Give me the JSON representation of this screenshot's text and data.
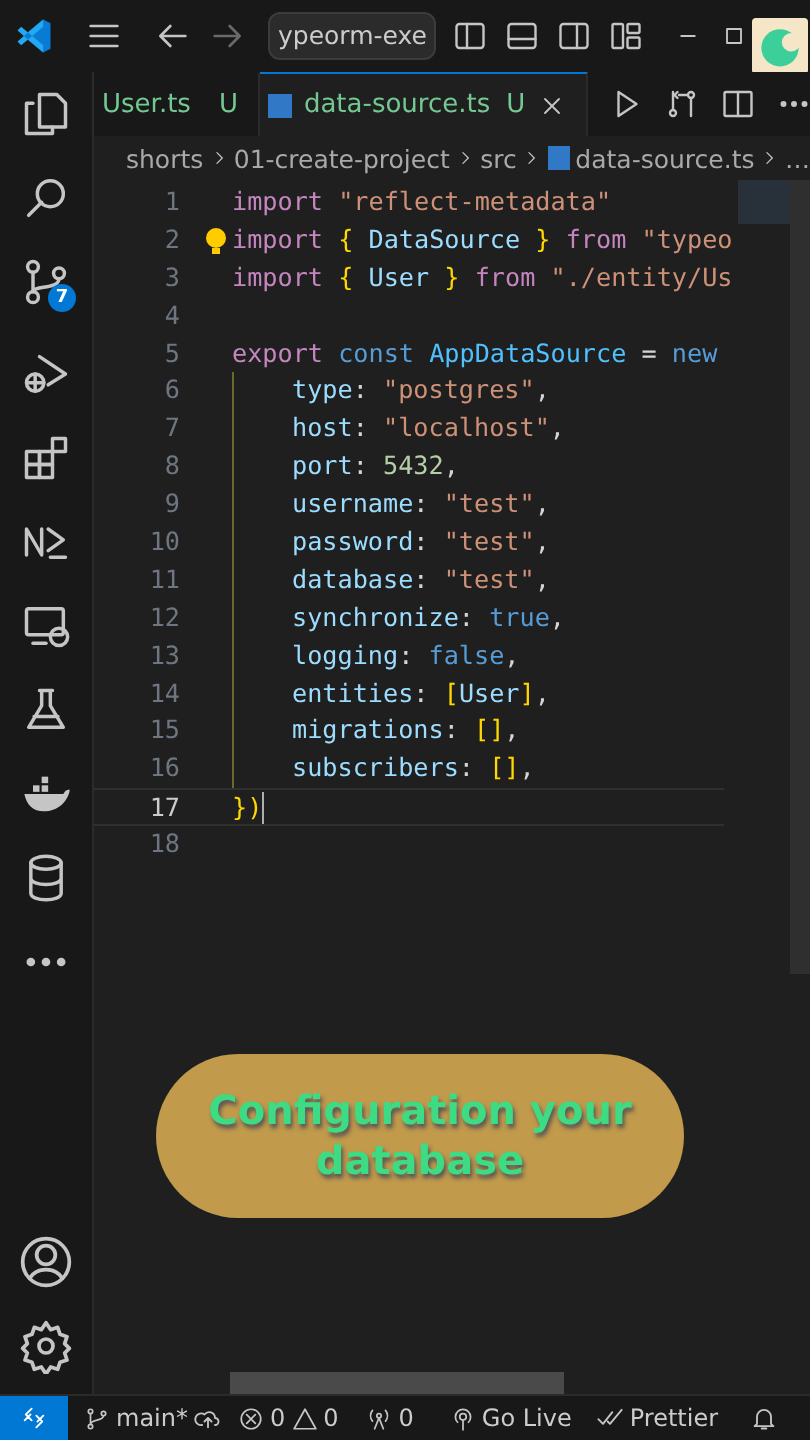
{
  "title_bar": {
    "search": "ypeorm-exe"
  },
  "tabs": [
    {
      "label": "User.ts",
      "status": "U",
      "selected": false
    },
    {
      "label": "data-source.ts",
      "status": "U",
      "selected": true
    }
  ],
  "breadcrumb": [
    "shorts",
    "01-create-project",
    "src",
    "data-source.ts",
    "…"
  ],
  "source_control_badge": "7",
  "editor": {
    "lines": [
      {
        "number": "1",
        "indented": false,
        "current": false,
        "tokens": [
          {
            "kind": "keyword",
            "text": "import "
          },
          {
            "kind": "string",
            "text": "\"reflect-metadata\""
          }
        ]
      },
      {
        "number": "2",
        "indented": false,
        "current": false,
        "tokens": [
          {
            "kind": "keyword",
            "text": "import "
          },
          {
            "kind": "brace",
            "text": "{"
          },
          {
            "kind": "variable",
            "text": " DataSource "
          },
          {
            "kind": "brace",
            "text": "} "
          },
          {
            "kind": "keyword",
            "text": "from "
          },
          {
            "kind": "string",
            "text": "\"typeo"
          }
        ]
      },
      {
        "number": "3",
        "indented": false,
        "current": false,
        "tokens": [
          {
            "kind": "keyword",
            "text": "import "
          },
          {
            "kind": "brace",
            "text": "{"
          },
          {
            "kind": "variable",
            "text": " User "
          },
          {
            "kind": "brace",
            "text": "} "
          },
          {
            "kind": "keyword",
            "text": "from "
          },
          {
            "kind": "string",
            "text": "\"./entity/Us"
          }
        ]
      },
      {
        "number": "4",
        "indented": false,
        "current": false
      },
      {
        "number": "5",
        "indented": false,
        "current": false,
        "tokens": [
          {
            "kind": "keyword",
            "text": "export "
          },
          {
            "kind": "storage",
            "text": "const "
          },
          {
            "kind": "constant",
            "text": "AppDataSource"
          },
          {
            "kind": "plain",
            "text": " = "
          },
          {
            "kind": "storage",
            "text": "new"
          }
        ]
      },
      {
        "number": "6",
        "indented": true,
        "current": false,
        "tokens": [
          {
            "kind": "variable",
            "text": "type"
          },
          {
            "kind": "plain",
            "text": ": "
          },
          {
            "kind": "string",
            "text": "\"postgres\""
          },
          {
            "kind": "plain",
            "text": ","
          }
        ]
      },
      {
        "number": "7",
        "indented": true,
        "current": false,
        "tokens": [
          {
            "kind": "variable",
            "text": "host"
          },
          {
            "kind": "plain",
            "text": ": "
          },
          {
            "kind": "string",
            "text": "\"localhost\""
          },
          {
            "kind": "plain",
            "text": ","
          }
        ]
      },
      {
        "number": "8",
        "indented": true,
        "current": false,
        "tokens": [
          {
            "kind": "variable",
            "text": "port"
          },
          {
            "kind": "plain",
            "text": ": "
          },
          {
            "kind": "number",
            "text": "5432"
          },
          {
            "kind": "plain",
            "text": ","
          }
        ]
      },
      {
        "number": "9",
        "indented": true,
        "current": false,
        "tokens": [
          {
            "kind": "variable",
            "text": "username"
          },
          {
            "kind": "plain",
            "text": ": "
          },
          {
            "kind": "string",
            "text": "\"test\""
          },
          {
            "kind": "plain",
            "text": ","
          }
        ]
      },
      {
        "number": "10",
        "indented": true,
        "current": false,
        "tokens": [
          {
            "kind": "variable",
            "text": "password"
          },
          {
            "kind": "plain",
            "text": ": "
          },
          {
            "kind": "string",
            "text": "\"test\""
          },
          {
            "kind": "plain",
            "text": ","
          }
        ]
      },
      {
        "number": "11",
        "indented": true,
        "current": false,
        "tokens": [
          {
            "kind": "variable",
            "text": "database"
          },
          {
            "kind": "plain",
            "text": ": "
          },
          {
            "kind": "string",
            "text": "\"test\""
          },
          {
            "kind": "plain",
            "text": ","
          }
        ]
      },
      {
        "number": "12",
        "indented": true,
        "current": false,
        "tokens": [
          {
            "kind": "variable",
            "text": "synchronize"
          },
          {
            "kind": "plain",
            "text": ": "
          },
          {
            "kind": "storage",
            "text": "true"
          },
          {
            "kind": "plain",
            "text": ","
          }
        ]
      },
      {
        "number": "13",
        "indented": true,
        "current": false,
        "tokens": [
          {
            "kind": "variable",
            "text": "logging"
          },
          {
            "kind": "plain",
            "text": ": "
          },
          {
            "kind": "storage",
            "text": "false"
          },
          {
            "kind": "plain",
            "text": ","
          }
        ]
      },
      {
        "number": "14",
        "indented": true,
        "current": false,
        "tokens": [
          {
            "kind": "variable",
            "text": "entities"
          },
          {
            "kind": "plain",
            "text": ": "
          },
          {
            "kind": "brace",
            "text": "["
          },
          {
            "kind": "variable",
            "text": "User"
          },
          {
            "kind": "brace",
            "text": "]"
          },
          {
            "kind": "plain",
            "text": ","
          }
        ]
      },
      {
        "number": "15",
        "indented": true,
        "current": false,
        "tokens": [
          {
            "kind": "variable",
            "text": "migrations"
          },
          {
            "kind": "plain",
            "text": ": "
          },
          {
            "kind": "brace",
            "text": "[]"
          },
          {
            "kind": "plain",
            "text": ","
          }
        ]
      },
      {
        "number": "16",
        "indented": true,
        "current": false,
        "tokens": [
          {
            "kind": "variable",
            "text": "subscribers"
          },
          {
            "kind": "plain",
            "text": ": "
          },
          {
            "kind": "brace",
            "text": "[]"
          },
          {
            "kind": "plain",
            "text": ","
          }
        ]
      },
      {
        "number": "17",
        "indented": false,
        "current": true,
        "tokens": [
          {
            "kind": "brace",
            "text": "})"
          }
        ]
      },
      {
        "number": "18",
        "indented": false,
        "current": false
      }
    ]
  },
  "caption": "Configuration your database",
  "status_bar": {
    "branch": "main*",
    "errors": "0",
    "warnings": "0",
    "ports": "0",
    "live": "Go Live",
    "formatter": "Prettier"
  }
}
